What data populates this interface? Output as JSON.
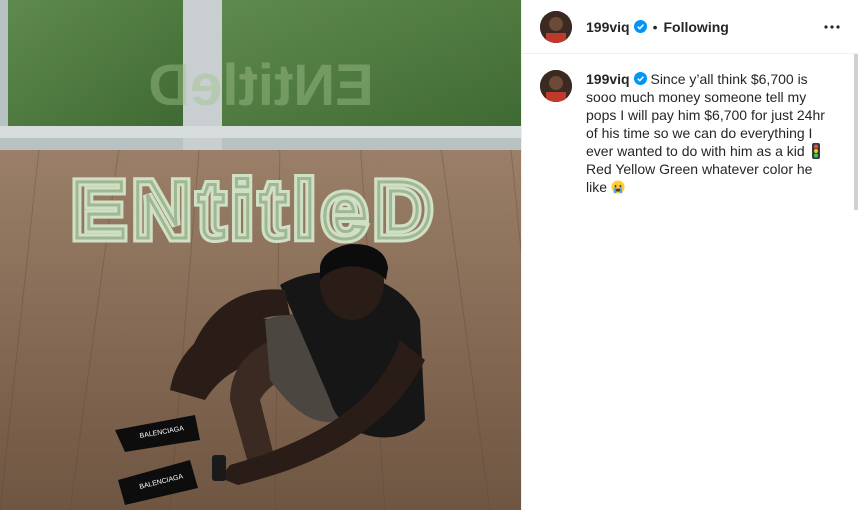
{
  "post": {
    "author": {
      "username": "199viq",
      "verified": true,
      "follow_status": "Following"
    },
    "caption": {
      "username": "199viq",
      "text_part1": "Since y’all think $6,700 is sooo much money someone tell my pops I will pay him $6,700 for just 24hr of his time so we can do everything I ever wanted to do with him as a kid",
      "emoji1": "traffic-light",
      "text_part2": "Red Yellow Green whatever color he like",
      "emoji2": "crying-face"
    },
    "image": {
      "floor_text": "ENtitleD"
    }
  },
  "icons": {
    "verified": "verified-badge-icon",
    "more": "more-options-icon"
  },
  "colors": {
    "verified_blue": "#0095f6",
    "text": "#262626",
    "border": "#efefef"
  }
}
